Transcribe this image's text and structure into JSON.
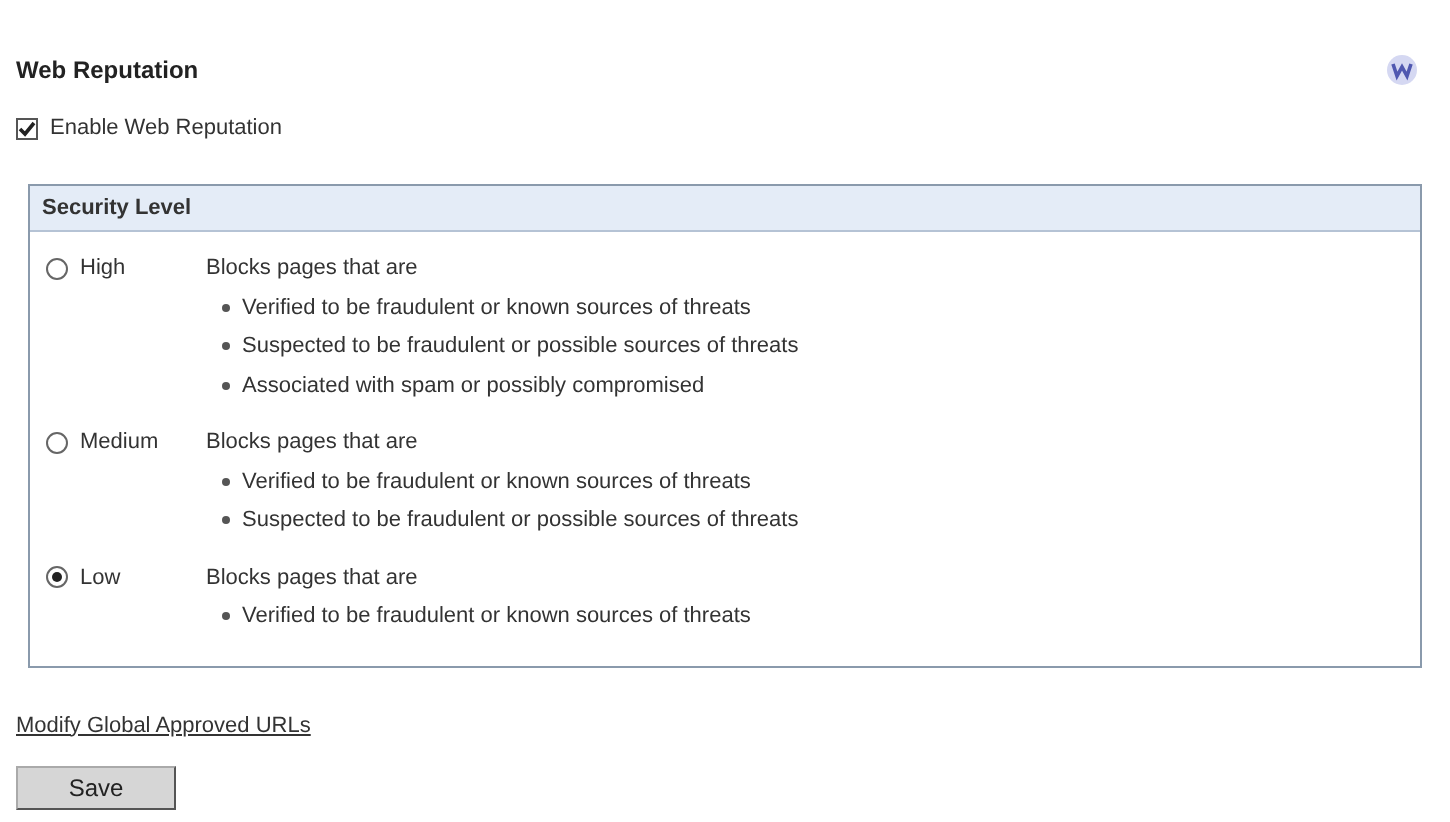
{
  "title": "Web Reputation",
  "enable": {
    "label": "Enable Web Reputation",
    "checked": true
  },
  "security_level": {
    "title": "Security Level",
    "levels": [
      {
        "label": "High",
        "selected": false,
        "intro": "Blocks pages that are",
        "items": [
          "Verified to be fraudulent or known sources of threats",
          "Suspected to be fraudulent or possible sources of threats",
          "Associated with spam or possibly compromised"
        ]
      },
      {
        "label": "Medium",
        "selected": false,
        "intro": "Blocks pages that are",
        "items": [
          "Verified to be fraudulent or known sources of threats",
          "Suspected to be fraudulent or possible sources of threats"
        ]
      },
      {
        "label": "Low",
        "selected": true,
        "intro": "Blocks pages that are",
        "items": [
          "Verified to be fraudulent or known sources of threats"
        ]
      }
    ]
  },
  "link": "Modify Global Approved URLs",
  "save_button": "Save"
}
